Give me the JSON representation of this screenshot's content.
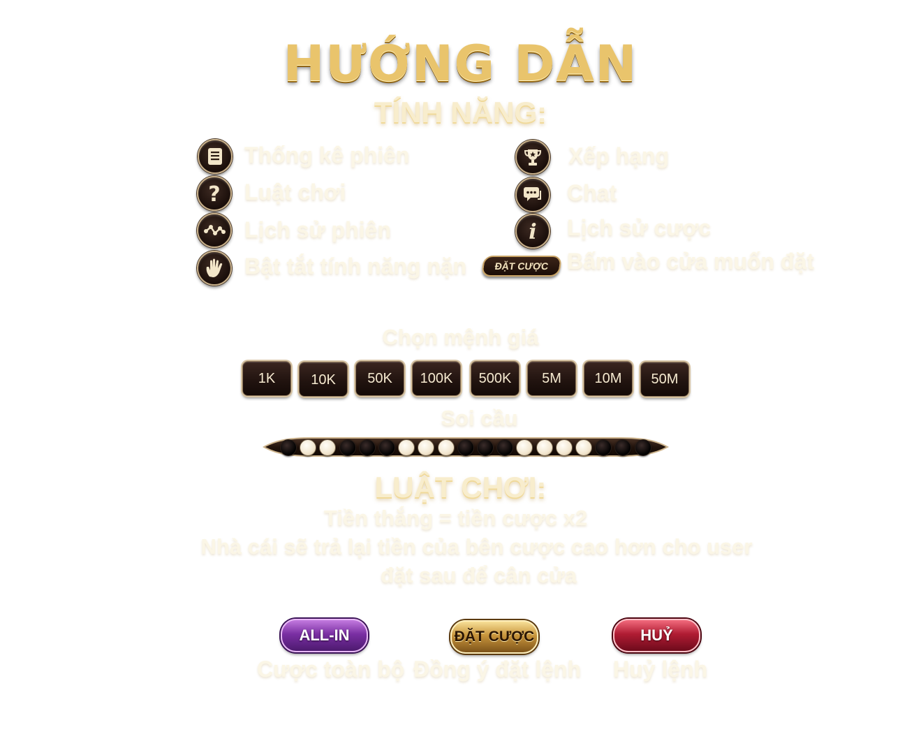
{
  "title": "HƯỚNG DẪN",
  "features_heading": "TÍNH NĂNG:",
  "features": [
    {
      "icon": "stats-list-icon",
      "label": "Thống kê phiên"
    },
    {
      "icon": "question-mark-icon",
      "label": "Luật chơi"
    },
    {
      "icon": "history-chart-icon",
      "label": "Lịch sử phiên"
    },
    {
      "icon": "hand-icon",
      "label": "Bật tắt tính năng nặn"
    },
    {
      "icon": "trophy-icon",
      "label": "Xếp hạng"
    },
    {
      "icon": "chat-icon",
      "label": "Chat"
    },
    {
      "icon": "info-icon",
      "label": "Lịch sử cược"
    }
  ],
  "bet_feature": {
    "button_label": "ĐẶT CƯỢC",
    "label": "Bấm vào cửa muốn đặt"
  },
  "denomination_heading": "Chọn mệnh giá",
  "denominations": [
    "1K",
    "10K",
    "50K",
    "100K",
    "500K",
    "5M",
    "10M",
    "50M"
  ],
  "soi_cau_heading": "Soi cầu",
  "soi_cau_results": [
    "dark",
    "light",
    "light",
    "dark",
    "dark",
    "dark",
    "light",
    "light",
    "light",
    "dark",
    "dark",
    "dark",
    "light",
    "light",
    "light",
    "light",
    "dark",
    "dark",
    "dark"
  ],
  "rules_heading": "LUẬT CHƠI:",
  "rules": [
    "Tiền thắng = tiền cược x2",
    "Nhà cái sẽ trả lại tiền của bên cược cao hơn cho user",
    "đặt sau để cân cửa"
  ],
  "actions": {
    "allin": {
      "label": "ALL-IN",
      "caption": "Cược toàn bộ"
    },
    "dat_cuoc": {
      "label": "ĐẶT CƯỢC",
      "caption": "Đồng ý đặt lệnh"
    },
    "huy": {
      "label": "HUỶ",
      "caption": "Huỷ lệnh"
    }
  },
  "colors": {
    "gold": "#e9c46c",
    "allin": "#7a2fa3",
    "dat_cuoc": "#c8953c",
    "huy": "#b01c33"
  }
}
